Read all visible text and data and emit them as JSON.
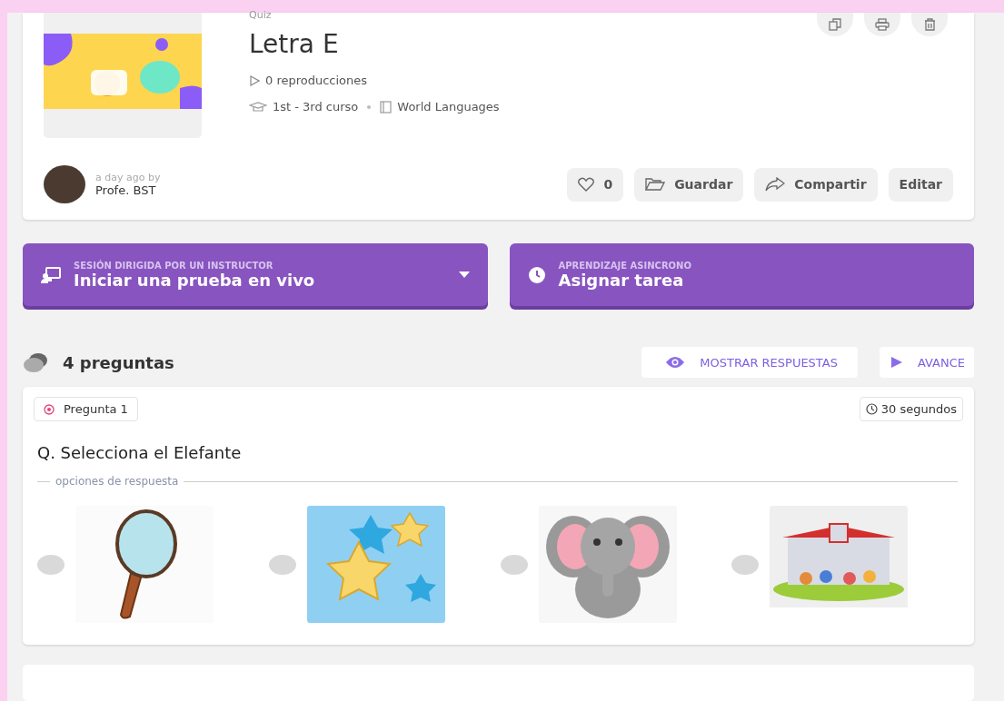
{
  "quiz": {
    "type_label": "Quiz",
    "title": "Letra E",
    "plays": "0 reproducciones",
    "grade": "1st - 3rd curso",
    "subject": "World Languages",
    "time_ago": "a day ago by",
    "author": "Profe. BST",
    "likes": "0",
    "actions": [
      {
        "kind": "save",
        "label": "Guardar"
      },
      {
        "kind": "share",
        "label": "Compartir"
      },
      {
        "kind": "edit",
        "label": "Editar"
      }
    ]
  },
  "modes": [
    {
      "kind": "live",
      "caption": "SESIÓN DIRIGIDA POR UN INSTRUCTOR",
      "label": "Iniciar una prueba en vivo"
    },
    {
      "kind": "homework",
      "caption": "APRENDIZAJE ASINCRONO",
      "label": "Asignar tarea"
    }
  ],
  "questions_header": {
    "count": "4 preguntas",
    "show_answers": "MOSTRAR RESPUESTAS",
    "preview": "AVANCE"
  },
  "question": {
    "number": "Pregunta 1",
    "time": "30 segundos",
    "text": "Q. Selecciona el Elefante",
    "options_label": "opciones de respuesta",
    "options": [
      {
        "kind": "magnifier",
        "selected": false
      },
      {
        "kind": "stars",
        "selected": false
      },
      {
        "kind": "elephant",
        "selected": false
      },
      {
        "kind": "school",
        "selected": false
      }
    ]
  }
}
